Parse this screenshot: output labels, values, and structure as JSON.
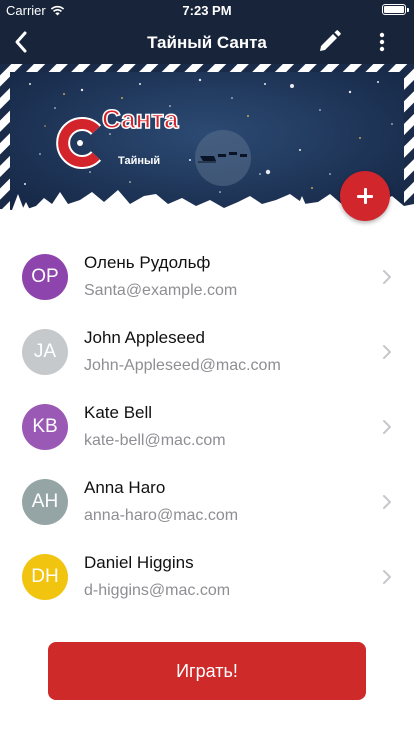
{
  "status_bar": {
    "carrier": "Carrier",
    "time": "7:23 PM"
  },
  "nav": {
    "title": "Тайный Санта",
    "back_icon": "chevron-left-icon",
    "edit_icon": "pencil-icon",
    "more_icon": "more-vertical-icon"
  },
  "banner": {
    "logo_main": "Санта",
    "logo_sub": "Тайный"
  },
  "add_button_icon": "plus-icon",
  "contacts": [
    {
      "initials": "OP",
      "name": "Олень Рудольф",
      "email": "Santa@example.com",
      "color": "#8e44ad"
    },
    {
      "initials": "JA",
      "name": "John Appleseed",
      "email": "John-Appleseed@mac.com",
      "color": "#c5c9cc"
    },
    {
      "initials": "KB",
      "name": "Kate Bell",
      "email": "kate-bell@mac.com",
      "color": "#9b59b6"
    },
    {
      "initials": "AH",
      "name": "Anna Haro",
      "email": "anna-haro@mac.com",
      "color": "#95a5a6"
    },
    {
      "initials": "DH",
      "name": "Daniel Higgins",
      "email": "d-higgins@mac.com",
      "color": "#f1c40f"
    }
  ],
  "play_button": "Играть!",
  "colors": {
    "nav_bg": "#17243a",
    "accent_red": "#cf2a2a"
  }
}
